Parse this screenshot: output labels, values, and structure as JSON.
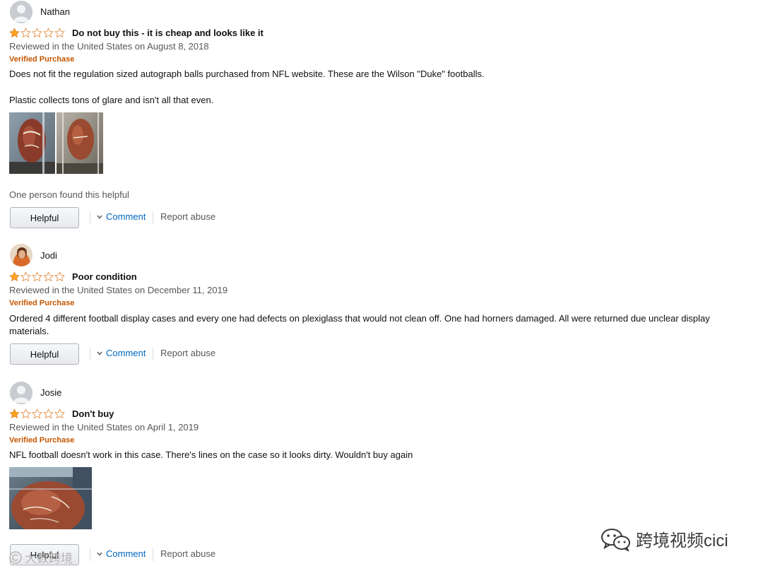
{
  "reviews": [
    {
      "reviewer": "Nathan",
      "rating": 1,
      "rating_max": 5,
      "title": "Do not buy this - it is cheap and looks like it",
      "date_text": "Reviewed in the United States on August 8, 2018",
      "verified": "Verified Purchase",
      "body_1": "Does not fit the regulation sized autograph balls purchased from NFL website. These are the Wilson \"Duke\" footballs.",
      "body_2": "Plastic collects tons of glare and isn't all that even.",
      "helpful_count": "One person found this helpful",
      "helpful_label": "Helpful",
      "comment_label": "Comment",
      "report_label": "Report abuse"
    },
    {
      "reviewer": "Jodi",
      "rating": 1,
      "rating_max": 5,
      "title": "Poor condition",
      "date_text": "Reviewed in the United States on December 11, 2019",
      "verified": "Verified Purchase",
      "body_1": "Ordered 4 different football display cases and every one had defects on plexiglass that would not clean off. One had horners damaged. All were returned due unclear display materials.",
      "helpful_label": "Helpful",
      "comment_label": "Comment",
      "report_label": "Report abuse"
    },
    {
      "reviewer": "Josie",
      "rating": 1,
      "rating_max": 5,
      "title": "Don't buy",
      "date_text": "Reviewed in the United States on April 1, 2019",
      "verified": "Verified Purchase",
      "body_1": "NFL football doesn't work in this case. There's lines on the case so it looks dirty. Wouldn't buy again",
      "helpful_label": "Helpful",
      "comment_label": "Comment",
      "report_label": "Report abuse"
    }
  ],
  "watermarks": {
    "right": "跨境视频cici",
    "bottom_left": "大数跨境"
  },
  "colors": {
    "star_fill": "#ffa41c",
    "star_outline": "#de7921",
    "verified": "#c45500",
    "link": "#0066c0",
    "meta": "#565959"
  },
  "icons": {
    "avatar_default": "person-silhouette-icon",
    "avatar_photo": "profile-photo",
    "comment_chevron": "chevron-down-icon",
    "watermark": "wechat-icon",
    "watermark_bottom": "copyright-icon"
  }
}
